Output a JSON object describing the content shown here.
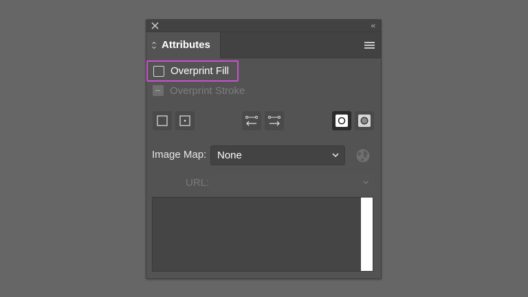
{
  "panel": {
    "tab_label": "Attributes",
    "collapse_glyph": "‹‹"
  },
  "checkboxes": {
    "overprint_fill": {
      "label": "Overprint Fill",
      "checked": false,
      "highlight_color": "#c94fd3"
    },
    "overprint_stroke": {
      "label": "Overprint Stroke",
      "checked": false,
      "disabled": true
    }
  },
  "toolbar": {
    "icons": [
      "dont-show-center-icon",
      "show-center-icon",
      "reverse-path-direction-off-icon",
      "reverse-path-direction-on-icon",
      "non-zero-winding-fill-rule-icon",
      "even-odd-fill-rule-icon"
    ],
    "active_icon": "non-zero-winding-fill-rule-icon"
  },
  "image_map": {
    "label": "Image Map:",
    "selected": "None"
  },
  "url": {
    "label": "URL:",
    "value": ""
  },
  "colors": {
    "background": "#666666",
    "panel": "#535353",
    "highlight": "#c94fd3"
  }
}
